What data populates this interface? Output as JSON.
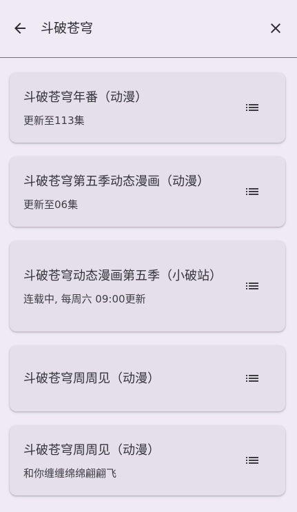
{
  "header": {
    "back_icon": "arrow-left-icon",
    "search_text": "斗破苍穹",
    "close_icon": "close-icon"
  },
  "results": [
    {
      "title": "斗破苍穹年番（动漫）",
      "subtitle": "更新至113集",
      "icon": "list-icon"
    },
    {
      "title": "斗破苍穹第五季动态漫画（动漫）",
      "subtitle": "更新至06集",
      "icon": "list-icon"
    },
    {
      "title": "斗破苍穹动态漫画第五季（小破站）",
      "subtitle": "连载中, 每周六 09:00更新",
      "icon": "list-icon"
    },
    {
      "title": "斗破苍穹周周见（动漫）",
      "subtitle": "",
      "icon": "list-icon"
    },
    {
      "title": "斗破苍穹周周见（动漫）",
      "subtitle": "和你缠缠绵绵翩翩飞",
      "icon": "list-icon"
    }
  ]
}
